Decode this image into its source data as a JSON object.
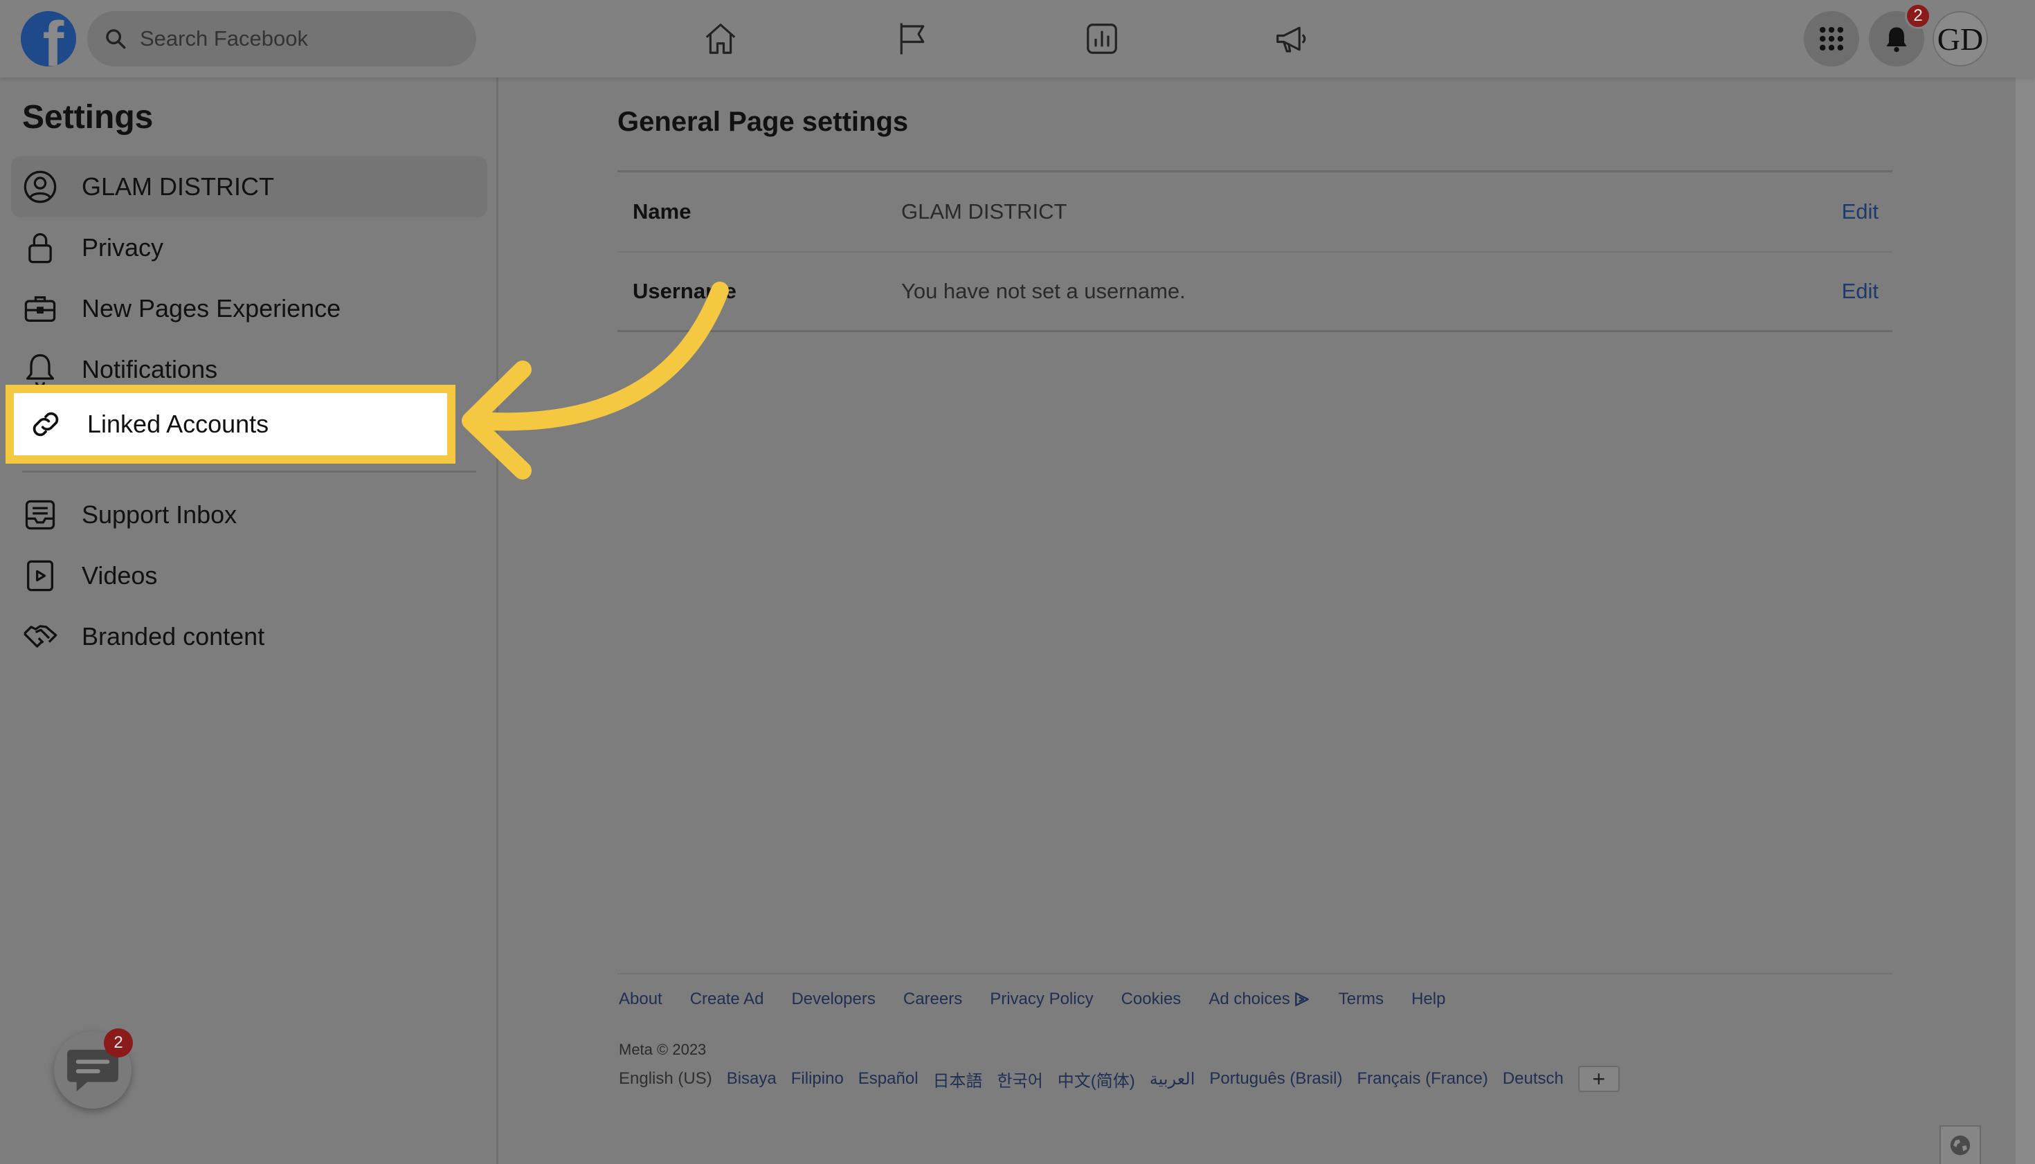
{
  "colors": {
    "accent_yellow": "#f5c842",
    "link_blue": "#1c3a6e",
    "badge_red": "#8b1a1a",
    "overlay_gray": "#7d7d7d"
  },
  "topbar": {
    "logo_glyph": "f",
    "search_placeholder": "Search Facebook",
    "icons": [
      "home-icon",
      "flag-icon",
      "insights-icon",
      "megaphone-icon"
    ],
    "notifications_count": "2",
    "avatar_text": "GD"
  },
  "sidebar": {
    "title": "Settings",
    "items": [
      {
        "label": "GLAM DISTRICT",
        "icon": "user-circle-icon"
      },
      {
        "label": "Privacy",
        "icon": "lock-icon"
      },
      {
        "label": "New Pages Experience",
        "icon": "briefcase-icon"
      },
      {
        "label": "Notifications",
        "icon": "bell-icon"
      },
      {
        "label": "Linked Accounts",
        "icon": "link-icon"
      },
      {
        "label": "Support Inbox",
        "icon": "inbox-icon"
      },
      {
        "label": "Videos",
        "icon": "video-icon"
      },
      {
        "label": "Branded content",
        "icon": "handshake-icon"
      }
    ]
  },
  "main": {
    "title": "General Page settings",
    "rows": [
      {
        "label": "Name",
        "value": "GLAM DISTRICT",
        "action": "Edit"
      },
      {
        "label": "Username",
        "value": "You have not set a username.",
        "action": "Edit"
      }
    ]
  },
  "footer": {
    "links": [
      "About",
      "Create Ad",
      "Developers",
      "Careers",
      "Privacy Policy",
      "Cookies",
      "Ad choices",
      "Terms",
      "Help"
    ],
    "copyright": "Meta © 2023",
    "current_language": "English (US)",
    "languages": [
      "Bisaya",
      "Filipino",
      "Español",
      "日本語",
      "한국어",
      "中文(简体)",
      "العربية",
      "Português (Brasil)",
      "Français (France)",
      "Deutsch"
    ],
    "add_language_glyph": "+"
  },
  "chat": {
    "badge_count": "2"
  }
}
